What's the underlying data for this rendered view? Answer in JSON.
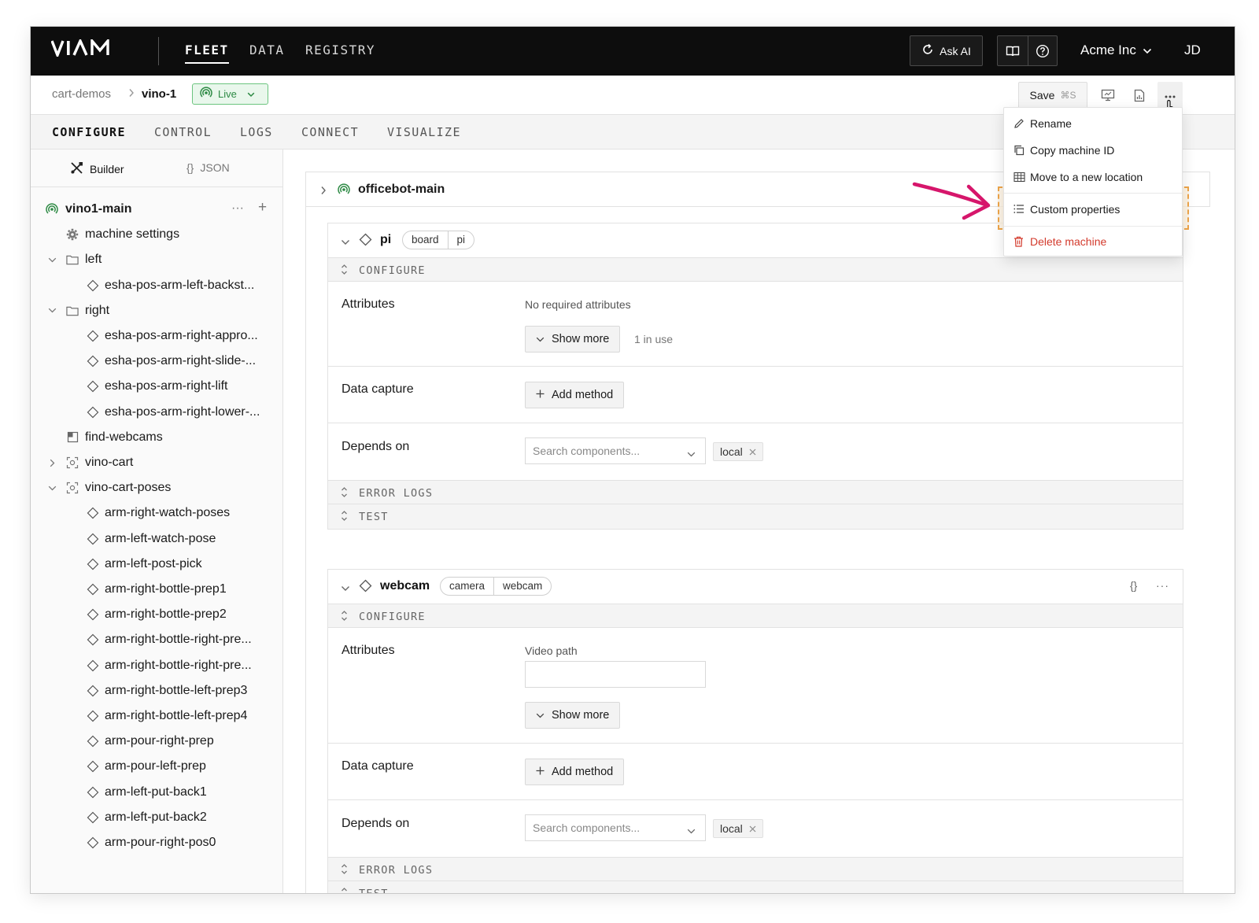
{
  "topnav": {
    "logo": "VIAM",
    "tabs": [
      "FLEET",
      "DATA",
      "REGISTRY"
    ],
    "ask_ai": "Ask AI",
    "org": "Acme Inc",
    "user_initials": "JD"
  },
  "breadcrumb": {
    "location": "cart-demos",
    "machine": "vino-1",
    "status": "Live"
  },
  "toolbar": {
    "save_label": "Save",
    "save_shortcut": "⌘S"
  },
  "subnav": {
    "tabs": [
      "CONFIGURE",
      "CONTROL",
      "LOGS",
      "CONNECT",
      "VISUALIZE"
    ]
  },
  "sidebar": {
    "mode_builder": "Builder",
    "mode_json": "JSON",
    "json_glyph": "{}",
    "tree": [
      {
        "label": "vino1-main",
        "level": 0,
        "icon": "live-signal-icon",
        "chevron": "none",
        "bold": true
      },
      {
        "label": "machine settings",
        "level": 1,
        "icon": "gear-icon",
        "chevron": "none"
      },
      {
        "label": "left",
        "level": 1,
        "icon": "folder-icon",
        "chevron": "down"
      },
      {
        "label": "esha-pos-arm-left-backst...",
        "level": 2,
        "icon": "diamond-icon",
        "chevron": "none"
      },
      {
        "label": "right",
        "level": 1,
        "icon": "folder-icon",
        "chevron": "down"
      },
      {
        "label": "esha-pos-arm-right-appro...",
        "level": 2,
        "icon": "diamond-icon",
        "chevron": "none"
      },
      {
        "label": "esha-pos-arm-right-slide-...",
        "level": 2,
        "icon": "diamond-icon",
        "chevron": "none"
      },
      {
        "label": "esha-pos-arm-right-lift",
        "level": 2,
        "icon": "diamond-icon",
        "chevron": "none"
      },
      {
        "label": "esha-pos-arm-right-lower-...",
        "level": 2,
        "icon": "diamond-icon",
        "chevron": "none"
      },
      {
        "label": "find-webcams",
        "level": 1,
        "icon": "module-icon",
        "chevron": "none"
      },
      {
        "label": "vino-cart",
        "level": 1,
        "icon": "fragment-icon",
        "chevron": "right"
      },
      {
        "label": "vino-cart-poses",
        "level": 1,
        "icon": "fragment-icon",
        "chevron": "down"
      },
      {
        "label": "arm-right-watch-poses",
        "level": 2,
        "icon": "diamond-icon",
        "chevron": "none"
      },
      {
        "label": "arm-left-watch-pose",
        "level": 2,
        "icon": "diamond-icon",
        "chevron": "none"
      },
      {
        "label": "arm-left-post-pick",
        "level": 2,
        "icon": "diamond-icon",
        "chevron": "none"
      },
      {
        "label": "arm-right-bottle-prep1",
        "level": 2,
        "icon": "diamond-icon",
        "chevron": "none"
      },
      {
        "label": "arm-right-bottle-prep2",
        "level": 2,
        "icon": "diamond-icon",
        "chevron": "none"
      },
      {
        "label": "arm-right-bottle-right-pre...",
        "level": 2,
        "icon": "diamond-icon",
        "chevron": "none"
      },
      {
        "label": "arm-right-bottle-right-pre...",
        "level": 2,
        "icon": "diamond-icon",
        "chevron": "none"
      },
      {
        "label": "arm-right-bottle-left-prep3",
        "level": 2,
        "icon": "diamond-icon",
        "chevron": "none"
      },
      {
        "label": "arm-right-bottle-left-prep4",
        "level": 2,
        "icon": "diamond-icon",
        "chevron": "none"
      },
      {
        "label": "arm-pour-right-prep",
        "level": 2,
        "icon": "diamond-icon",
        "chevron": "none"
      },
      {
        "label": "arm-pour-left-prep",
        "level": 2,
        "icon": "diamond-icon",
        "chevron": "none"
      },
      {
        "label": "arm-left-put-back1",
        "level": 2,
        "icon": "diamond-icon",
        "chevron": "none"
      },
      {
        "label": "arm-left-put-back2",
        "level": 2,
        "icon": "diamond-icon",
        "chevron": "none"
      },
      {
        "label": "arm-pour-right-pos0",
        "level": 2,
        "icon": "diamond-icon",
        "chevron": "none"
      }
    ],
    "row_actions": {
      "more": "···",
      "add": "+"
    }
  },
  "main": {
    "machine_part": "officebot-main",
    "components": [
      {
        "name": "pi",
        "api": "board",
        "model": "pi",
        "sections": {
          "configure": "CONFIGURE",
          "error_logs": "ERROR LOGS",
          "test": "TEST"
        },
        "attributes_label": "Attributes",
        "attributes_note": "No required attributes",
        "show_more": "Show more",
        "in_use": "1 in use",
        "data_capture_label": "Data capture",
        "add_method": "Add method",
        "depends_on_label": "Depends on",
        "search_placeholder": "Search components...",
        "dependency": "local"
      },
      {
        "name": "webcam",
        "api": "camera",
        "model": "webcam",
        "json_glyph": "{}",
        "more_glyph": "···",
        "sections": {
          "configure": "CONFIGURE",
          "error_logs": "ERROR LOGS",
          "test": "TEST"
        },
        "attributes_label": "Attributes",
        "video_path_label": "Video path",
        "video_path_value": "",
        "show_more": "Show more",
        "data_capture_label": "Data capture",
        "add_method": "Add method",
        "depends_on_label": "Depends on",
        "search_placeholder": "Search components...",
        "dependency": "local"
      }
    ]
  },
  "menu": {
    "items": [
      {
        "label": "Rename",
        "icon": "pencil-icon"
      },
      {
        "label": "Copy machine ID",
        "icon": "copy-icon"
      },
      {
        "label": "Move to a new location",
        "icon": "building-icon"
      },
      {
        "label": "Custom properties",
        "icon": "list-icon",
        "highlighted": true
      },
      {
        "label": "Delete machine",
        "icon": "trash-icon",
        "danger": true
      }
    ]
  },
  "colors": {
    "topnav_bg": "#0d0d0d",
    "live_green": "#2d8a44",
    "danger_red": "#d33a2c",
    "annotation_arrow": "#d6166b",
    "highlight_border": "#f0a64a"
  }
}
